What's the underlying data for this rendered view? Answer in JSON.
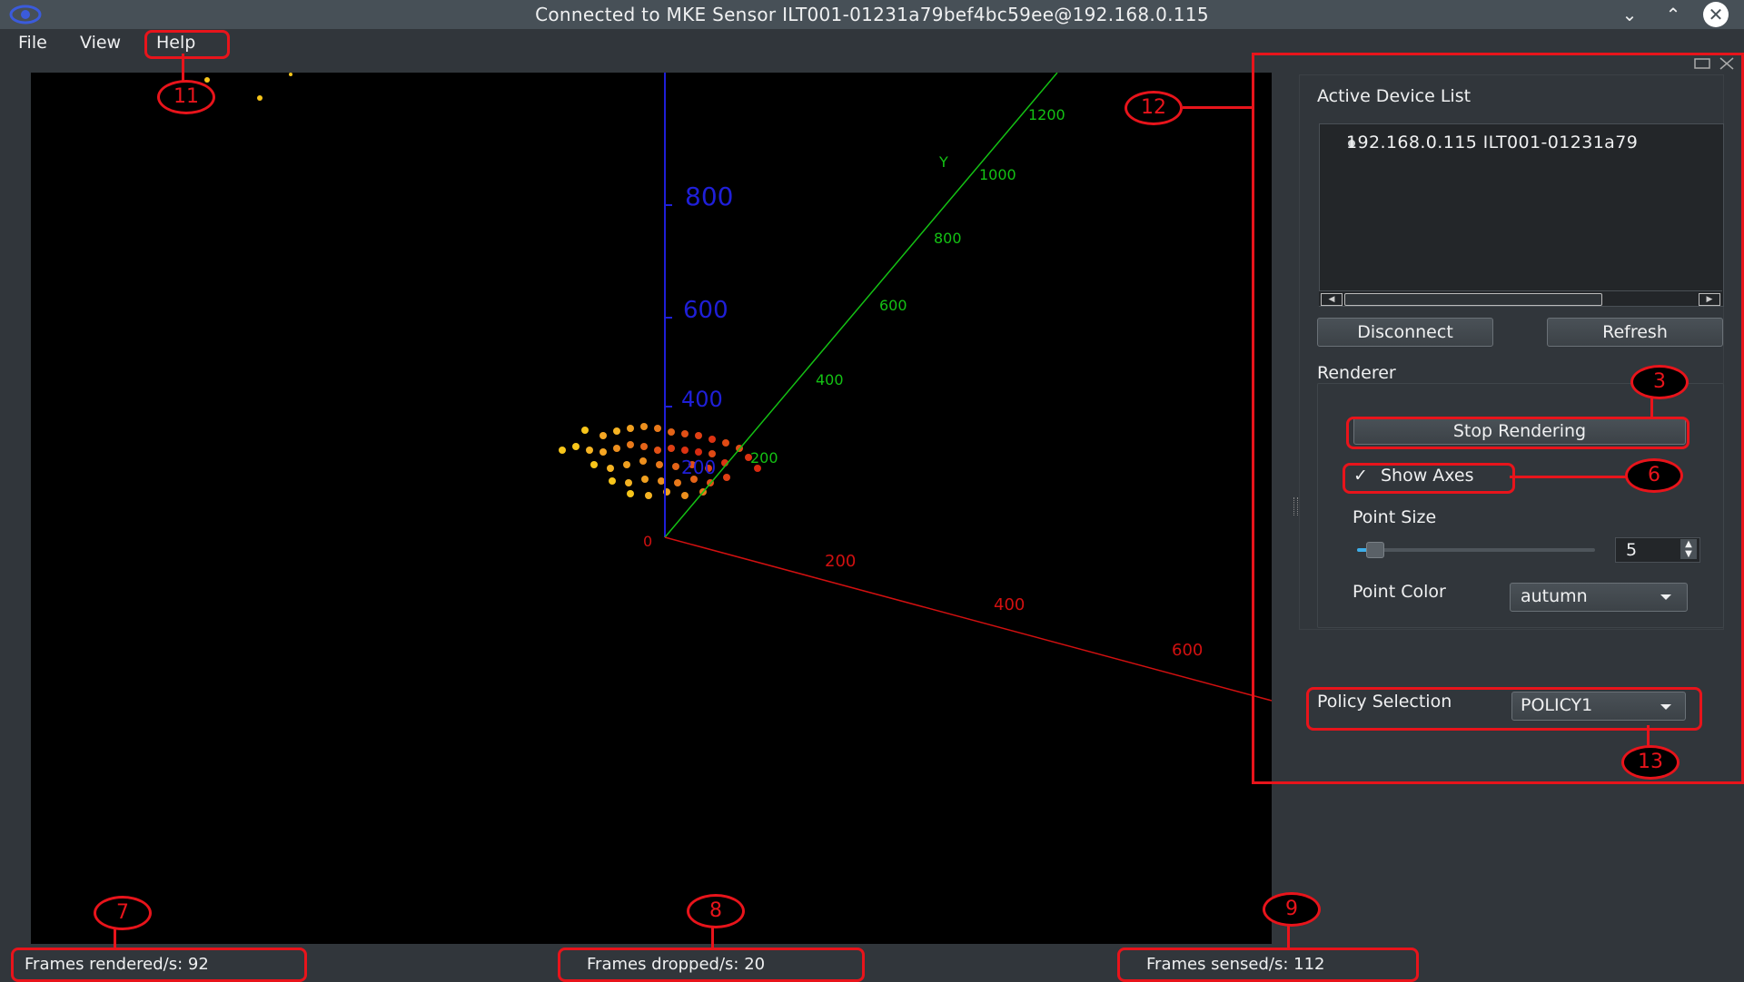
{
  "window": {
    "title": "Connected to MKE Sensor ILT001-01231a79bef4bc59ee@192.168.0.115",
    "icons": [
      "eye-icon",
      "minimize-icon",
      "maximize-icon",
      "close-icon"
    ]
  },
  "menu": {
    "file": "File",
    "view": "View",
    "help": "Help"
  },
  "viewport": {
    "z_ticks": [
      "800",
      "600",
      "400"
    ],
    "y_axis_label": "Y",
    "y_ticks": [
      "1200",
      "1000",
      "800",
      "600",
      "400",
      "200"
    ],
    "x_ticks": [
      "200",
      "400",
      "600"
    ],
    "origin": "0",
    "hidden_tick": "200",
    "colors": {
      "x_axis": "#d21010",
      "y_axis": "#14c214",
      "z_axis": "#1f1fd8",
      "background": "#000000"
    }
  },
  "status": {
    "rendered": "Frames rendered/s: 92",
    "dropped": "Frames dropped/s: 20",
    "sensed": "Frames sensed/s: 112"
  },
  "dock": {
    "device_list_label": "Active Device List",
    "device_item": "192.168.0.115 ILT001-01231a79",
    "disconnect": "Disconnect",
    "refresh": "Refresh",
    "renderer_label": "Renderer",
    "stop_rendering": "Stop Rendering",
    "show_axes": "Show Axes",
    "show_axes_checked": true,
    "point_size_label": "Point Size",
    "point_size_value": "5",
    "point_color_label": "Point Color",
    "point_color_value": "autumn",
    "policy_label": "Policy Selection",
    "policy_value": "POLICY1"
  },
  "annotations": {
    "color": "#e8141b",
    "markers": [
      "11",
      "12",
      "3",
      "6",
      "13",
      "7",
      "8",
      "9"
    ]
  }
}
